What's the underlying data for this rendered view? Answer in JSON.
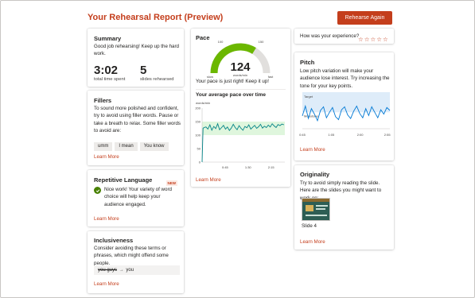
{
  "header": {
    "title": "Your Rehearsal Report (Preview)",
    "rehearse_label": "Rehearse Again"
  },
  "summary": {
    "title": "Summary",
    "message": "Good job rehearsing! Keep up the hard work.",
    "time_value": "3:02",
    "time_label": "total time spent",
    "slides_value": "5",
    "slides_label": "slides rehearsed"
  },
  "fillers": {
    "title": "Fillers",
    "message": "To sound more polished and confident, try to avoid using filler words. Pause or take a breath to relax. Some filler words to avoid are:",
    "chips": [
      "umm",
      "I mean",
      "You know"
    ],
    "learn_more": "Learn More"
  },
  "repetitive": {
    "title": "Repetitive Language",
    "badge": "NEW",
    "message": "Nice work! Your variety of word choice will help keep your audience engaged.",
    "learn_more": "Learn More"
  },
  "inclusiveness": {
    "title": "Inclusiveness",
    "message": "Consider avoiding these terms or phrases, which might offend some people.",
    "from": "you guys",
    "arrow": "→",
    "to": "you",
    "learn_more": "Learn More"
  },
  "pace": {
    "title": "Pace",
    "gauge_value": "124",
    "gauge_unit": "words/min",
    "gauge_min_tick": "100",
    "gauge_max_tick": "150",
    "slow_label": "slow",
    "fast_label": "fast",
    "message": "Your pace is just right! Keep it up!",
    "chart_title": "Your average pace over time",
    "learn_more": "Learn More"
  },
  "experience": {
    "question": "How was your experience?",
    "stars": [
      "☆",
      "☆",
      "☆",
      "☆",
      "☆"
    ]
  },
  "pitch": {
    "title": "Pitch",
    "message": "Low pitch variation will make your audience lose interest. Try increasing the tone for your key points.",
    "target_label": "Target",
    "monotone_label": "Monotone",
    "learn_more": "Learn More"
  },
  "originality": {
    "title": "Originality",
    "message": "Try to avoid simply reading the slide. Here are the slides you might want to work on:",
    "slide_label": "Slide 4",
    "learn_more": "Learn More"
  },
  "colors": {
    "accent": "#c43e1c",
    "gauge": "#6bb700",
    "band": "#dff6dd",
    "pitch_band": "#deecf9",
    "line": "#038387",
    "pitch_line": "#0078d4"
  },
  "chart_data": [
    {
      "type": "line",
      "title": "Your average pace over time",
      "ylabel": "words/min",
      "x_ticks": [
        "0:45",
        "1:30",
        "2:15"
      ],
      "y_ticks": [
        0,
        50,
        100,
        150,
        200
      ],
      "ylim": [
        0,
        200
      ],
      "xlim": [
        0,
        170
      ],
      "target_band": [
        100,
        150
      ],
      "x": [
        0,
        2,
        4,
        8,
        12,
        16,
        20,
        24,
        28,
        32,
        36,
        40,
        44,
        48,
        52,
        56,
        60,
        64,
        68,
        72,
        76,
        80,
        84,
        88,
        92,
        96,
        100,
        104,
        108,
        112,
        116,
        120,
        124,
        128,
        132,
        136,
        140,
        144,
        148,
        152,
        156,
        160,
        164,
        168
      ],
      "values": [
        0,
        125,
        128,
        130,
        122,
        138,
        118,
        132,
        124,
        142,
        120,
        128,
        136,
        122,
        130,
        117,
        126,
        140,
        128,
        120,
        135,
        125,
        118,
        132,
        127,
        138,
        122,
        129,
        136,
        125,
        131,
        140,
        126,
        133,
        128,
        137,
        130,
        142,
        134,
        128,
        139,
        135,
        141,
        138
      ]
    },
    {
      "type": "line",
      "title": "Pitch",
      "x_ticks": [
        "0:45",
        "1:05",
        "2:00",
        "2:55"
      ],
      "band_labels": [
        "Target",
        "Monotone"
      ],
      "ylim": [
        0,
        1
      ],
      "target_band": [
        0.45,
        1.0
      ],
      "x": [
        0,
        6,
        12,
        18,
        24,
        30,
        36,
        42,
        48,
        54,
        60,
        66,
        72,
        78,
        84,
        90,
        96,
        102,
        108,
        114,
        120,
        126,
        132,
        138,
        144,
        150,
        156,
        162,
        168,
        174
      ],
      "values": [
        0.35,
        0.62,
        0.28,
        0.55,
        0.4,
        0.22,
        0.5,
        0.6,
        0.3,
        0.45,
        0.58,
        0.33,
        0.25,
        0.52,
        0.6,
        0.38,
        0.28,
        0.48,
        0.62,
        0.42,
        0.3,
        0.55,
        0.36,
        0.6,
        0.45,
        0.3,
        0.52,
        0.4,
        0.58,
        0.5
      ]
    }
  ]
}
